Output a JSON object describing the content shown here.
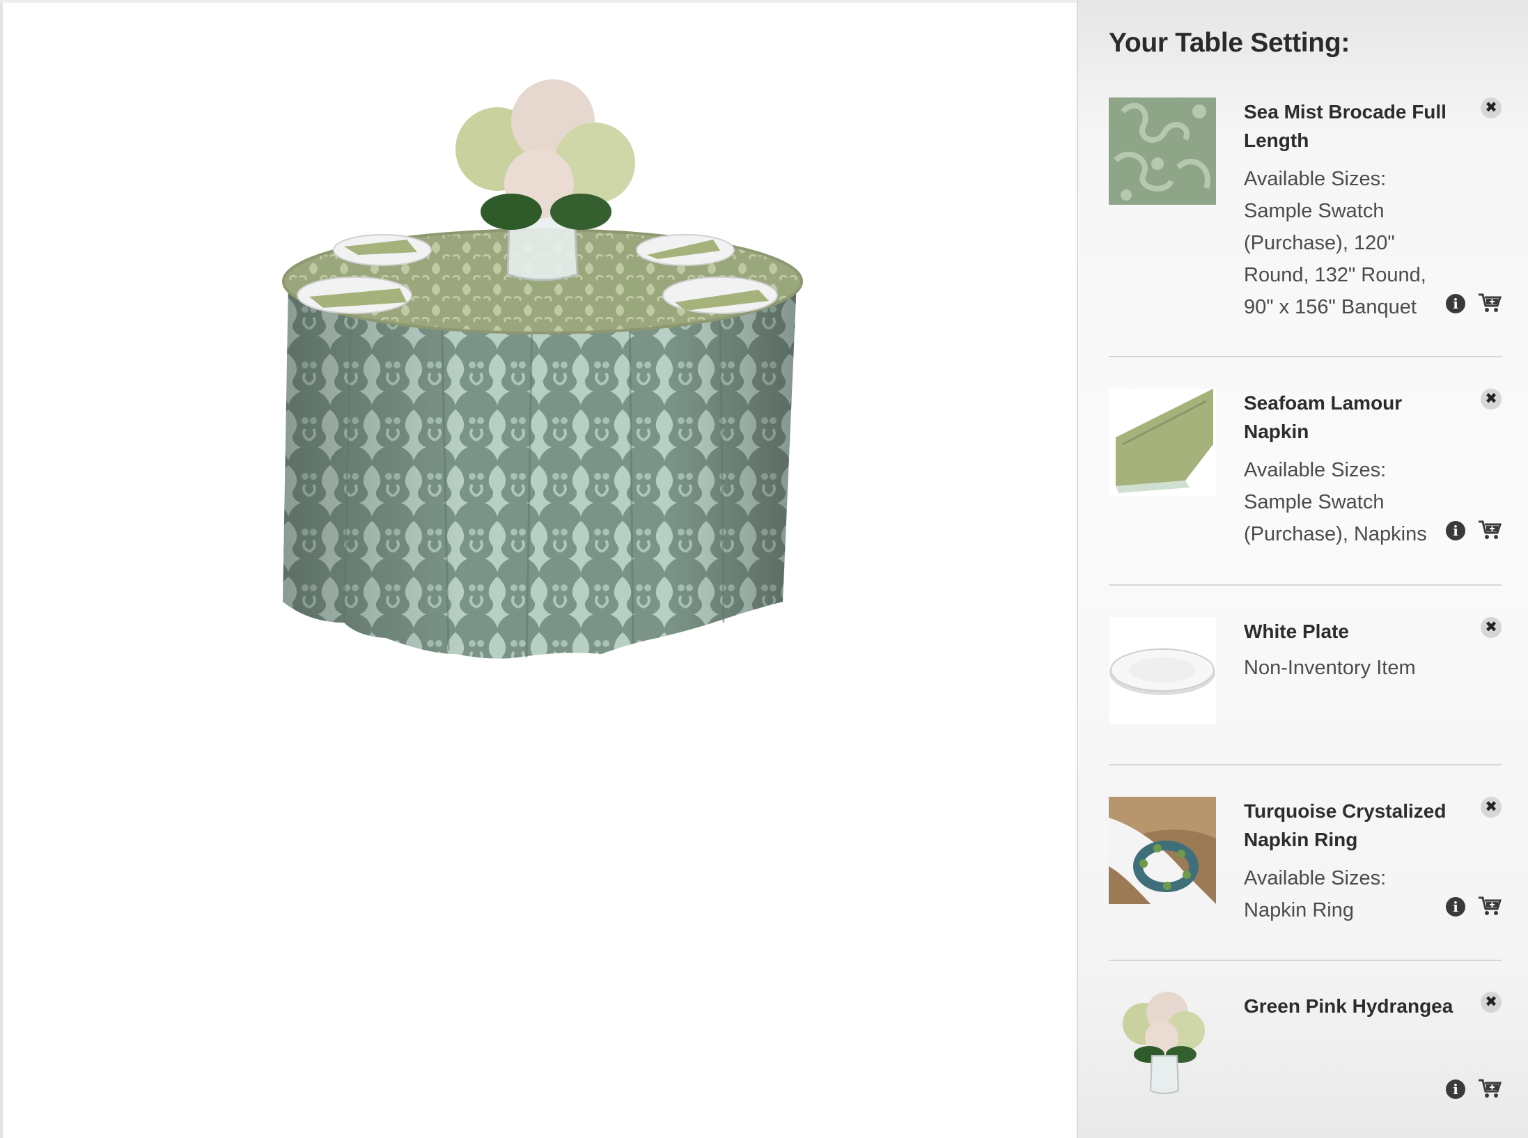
{
  "panel": {
    "title": "Your Table Setting:",
    "items": [
      {
        "name": "Sea Mist Brocade Full Length",
        "sizes_label": "Available Sizes:",
        "sizes": "Sample Swatch (Purchase), 120\" Round, 132\" Round, 90\" x 156\" Banquet",
        "thumb_icon": "brocade-fabric-swatch",
        "has_actions": true
      },
      {
        "name": "Seafoam Lamour Napkin",
        "sizes_label": "Available Sizes:",
        "sizes": "Sample Swatch (Purchase), Napkins",
        "thumb_icon": "folded-napkin",
        "has_actions": true
      },
      {
        "name": "White Plate",
        "note": "Non-Inventory Item",
        "thumb_icon": "white-plate",
        "has_actions": false
      },
      {
        "name": "Turquoise Crystalized Napkin Ring",
        "sizes_label": "Available Sizes:",
        "sizes": "Napkin Ring",
        "thumb_icon": "napkin-ring",
        "has_actions": true
      },
      {
        "name": "Green Pink Hydrangea",
        "thumb_icon": "hydrangea-centerpiece",
        "has_actions": true
      }
    ]
  },
  "buttons": {
    "remove": "✖",
    "info": "i"
  },
  "colors": {
    "panel_bg": "#f5f5f5",
    "tablecloth": "#8fa69a",
    "tablecloth_top": "#a9b58f",
    "napkin": "#a6b27c",
    "icon_dark": "#3a3a3a"
  },
  "preview": {
    "image": "round-table-sea-mist-brocade-with-hydrangea-centerpiece"
  }
}
